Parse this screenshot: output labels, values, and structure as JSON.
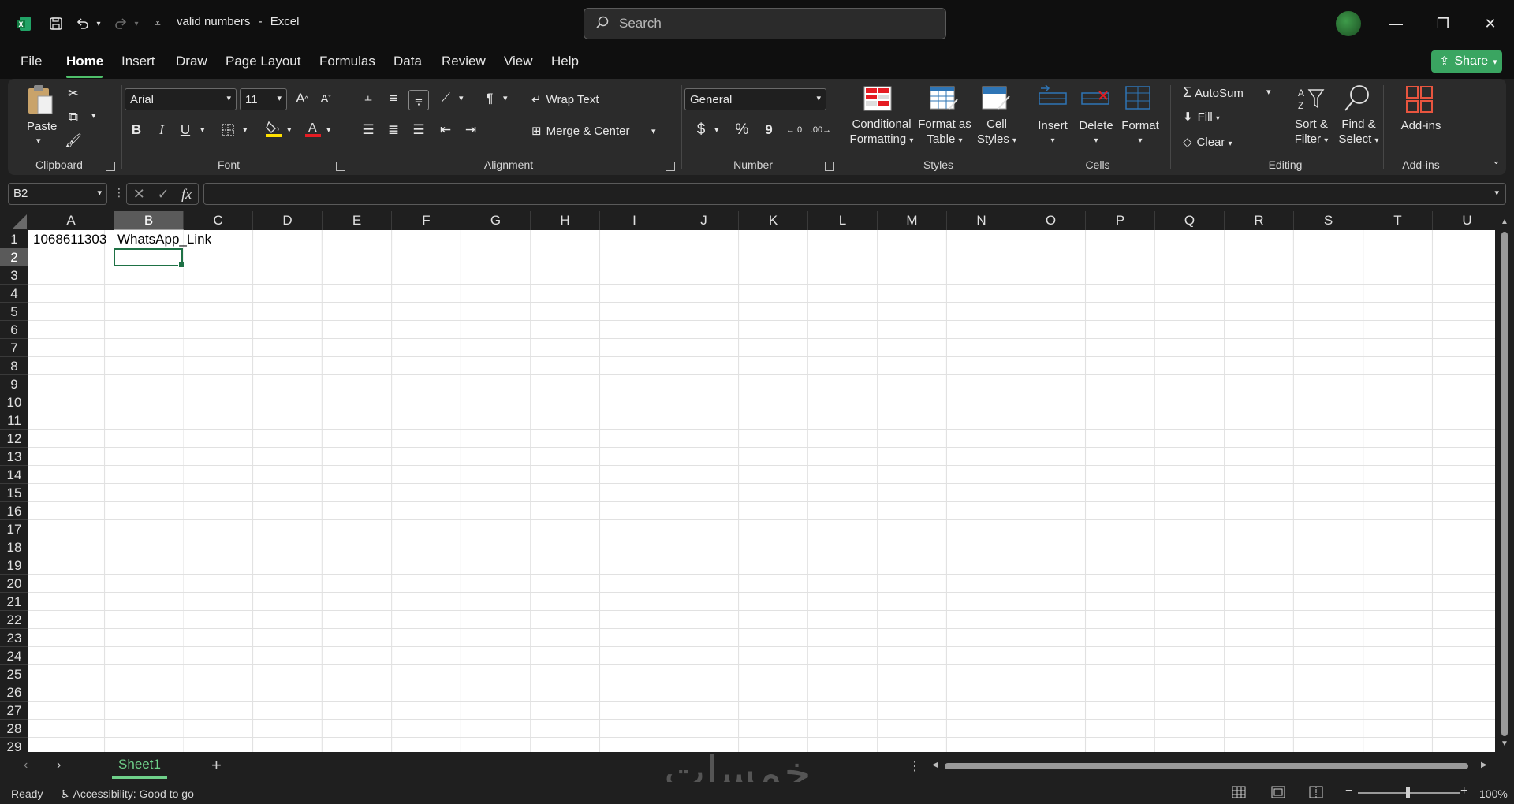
{
  "window": {
    "file_name": "valid numbers",
    "separator": "-",
    "app_name": "Excel",
    "search_placeholder": "Search",
    "minimize": "—",
    "restore": "❐",
    "close": "✕"
  },
  "menu": {
    "tabs": [
      "File",
      "Home",
      "Insert",
      "Draw",
      "Page Layout",
      "Formulas",
      "Data",
      "Review",
      "View",
      "Help"
    ],
    "active": "Home",
    "share_label": "Share"
  },
  "ribbon": {
    "clipboard": {
      "paste": "Paste",
      "label": "Clipboard"
    },
    "font": {
      "family": "Arial",
      "size": "11",
      "bold": "B",
      "italic": "I",
      "underline": "U",
      "label": "Font"
    },
    "alignment": {
      "wrap_text": "Wrap Text",
      "merge_center": "Merge & Center",
      "label": "Alignment"
    },
    "number": {
      "format": "General",
      "currency": "$",
      "percent": "%",
      "comma": "9",
      "label": "Number"
    },
    "styles": {
      "conditional_1": "Conditional",
      "conditional_2": "Formatting",
      "format_table_1": "Format as",
      "format_table_2": "Table",
      "cell_styles_1": "Cell",
      "cell_styles_2": "Styles",
      "label": "Styles"
    },
    "cells": {
      "insert": "Insert",
      "delete": "Delete",
      "format": "Format",
      "label": "Cells"
    },
    "editing": {
      "autosum": "AutoSum",
      "fill": "Fill",
      "clear": "Clear",
      "sort_1": "Sort &",
      "sort_2": "Filter",
      "find_1": "Find &",
      "find_2": "Select",
      "label": "Editing"
    },
    "addins": {
      "addins": "Add-ins",
      "label": "Add-ins"
    }
  },
  "formula_bar": {
    "name_box": "B2",
    "fx": "fx",
    "value": ""
  },
  "grid": {
    "columns": [
      "A",
      "B",
      "C",
      "D",
      "E",
      "F",
      "G",
      "H",
      "I",
      "J",
      "K",
      "L",
      "M",
      "N",
      "O",
      "P",
      "Q",
      "R",
      "S",
      "T",
      "U"
    ],
    "rows": [
      "1",
      "2",
      "3",
      "4",
      "5",
      "6",
      "7",
      "8",
      "9",
      "10",
      "11",
      "12",
      "13",
      "14",
      "15",
      "16",
      "17",
      "18",
      "19",
      "20",
      "21",
      "22",
      "23",
      "24",
      "25",
      "26",
      "27",
      "28",
      "29"
    ],
    "selected_column": "B",
    "selected_row": "2",
    "cells": {
      "A1": "1068611303",
      "B1": "WhatsApp_Link"
    }
  },
  "sheets": {
    "tabs": [
      "Sheet1"
    ],
    "add": "+"
  },
  "watermark": "خمسات",
  "status": {
    "ready": "Ready",
    "accessibility": "Accessibility: Good to go",
    "zoom": "100%"
  },
  "colors": {
    "accent_green": "#1e7145",
    "share_green": "#3aa561",
    "tab_green": "#6fd08a"
  }
}
